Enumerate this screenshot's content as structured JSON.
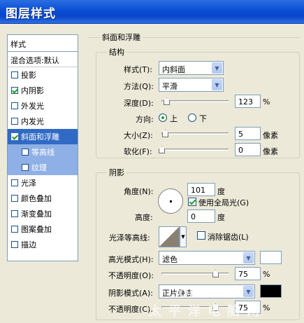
{
  "window": {
    "title": "图层样式"
  },
  "sidebar": {
    "header": "样式",
    "blend_label": "混合选项:默认",
    "items": [
      {
        "label": "投影",
        "checked": false
      },
      {
        "label": "内阴影",
        "checked": true
      },
      {
        "label": "外发光",
        "checked": false
      },
      {
        "label": "内发光",
        "checked": false
      },
      {
        "label": "斜面和浮雕",
        "checked": true,
        "selected": true
      },
      {
        "label": "等高线",
        "checked": false,
        "sub": true
      },
      {
        "label": "纹理",
        "checked": false,
        "sub": true
      },
      {
        "label": "光泽",
        "checked": false
      },
      {
        "label": "颜色叠加",
        "checked": false
      },
      {
        "label": "渐变叠加",
        "checked": false
      },
      {
        "label": "图案叠加",
        "checked": false
      },
      {
        "label": "描边",
        "checked": false
      }
    ]
  },
  "bevel": {
    "section_title": "斜面和浮雕",
    "structure": {
      "title": "结构",
      "style_label": "样式(T):",
      "style_value": "内斜面",
      "technique_label": "方法(Q):",
      "technique_value": "平滑",
      "depth_label": "深度(D):",
      "depth_value": "123",
      "depth_unit": "%",
      "direction_label": "方向:",
      "direction_up": "上",
      "direction_down": "下",
      "direction_selected": "up",
      "size_label": "大小(Z):",
      "size_value": "5",
      "size_unit": "像素",
      "soften_label": "软化(F):",
      "soften_value": "0",
      "soften_unit": "像素"
    },
    "shading": {
      "title": "阴影",
      "angle_label": "角度(N):",
      "angle_value": "101",
      "angle_unit": "度",
      "global_light_label": "使用全局光(G)",
      "global_light_checked": true,
      "altitude_label": "高度:",
      "altitude_value": "0",
      "altitude_unit": "度",
      "gloss_contour_label": "光泽等高线:",
      "anti_alias_label": "消除锯齿(L)",
      "anti_alias_checked": false,
      "highlight_mode_label": "高光模式(H):",
      "highlight_mode_value": "滤色",
      "highlight_color": "#ffffff",
      "highlight_opacity_label": "不透明度(O):",
      "highlight_opacity_value": "75",
      "shadow_mode_label": "阴影模式(A):",
      "shadow_mode_value": "正片叠底",
      "shadow_color": "#000000",
      "shadow_opacity_label": "不透明度(C):",
      "shadow_opacity_value": "75",
      "percent_unit": "%"
    }
  },
  "watermark": {
    "line1": "online",
    "line2": "太平洋电脑网"
  }
}
